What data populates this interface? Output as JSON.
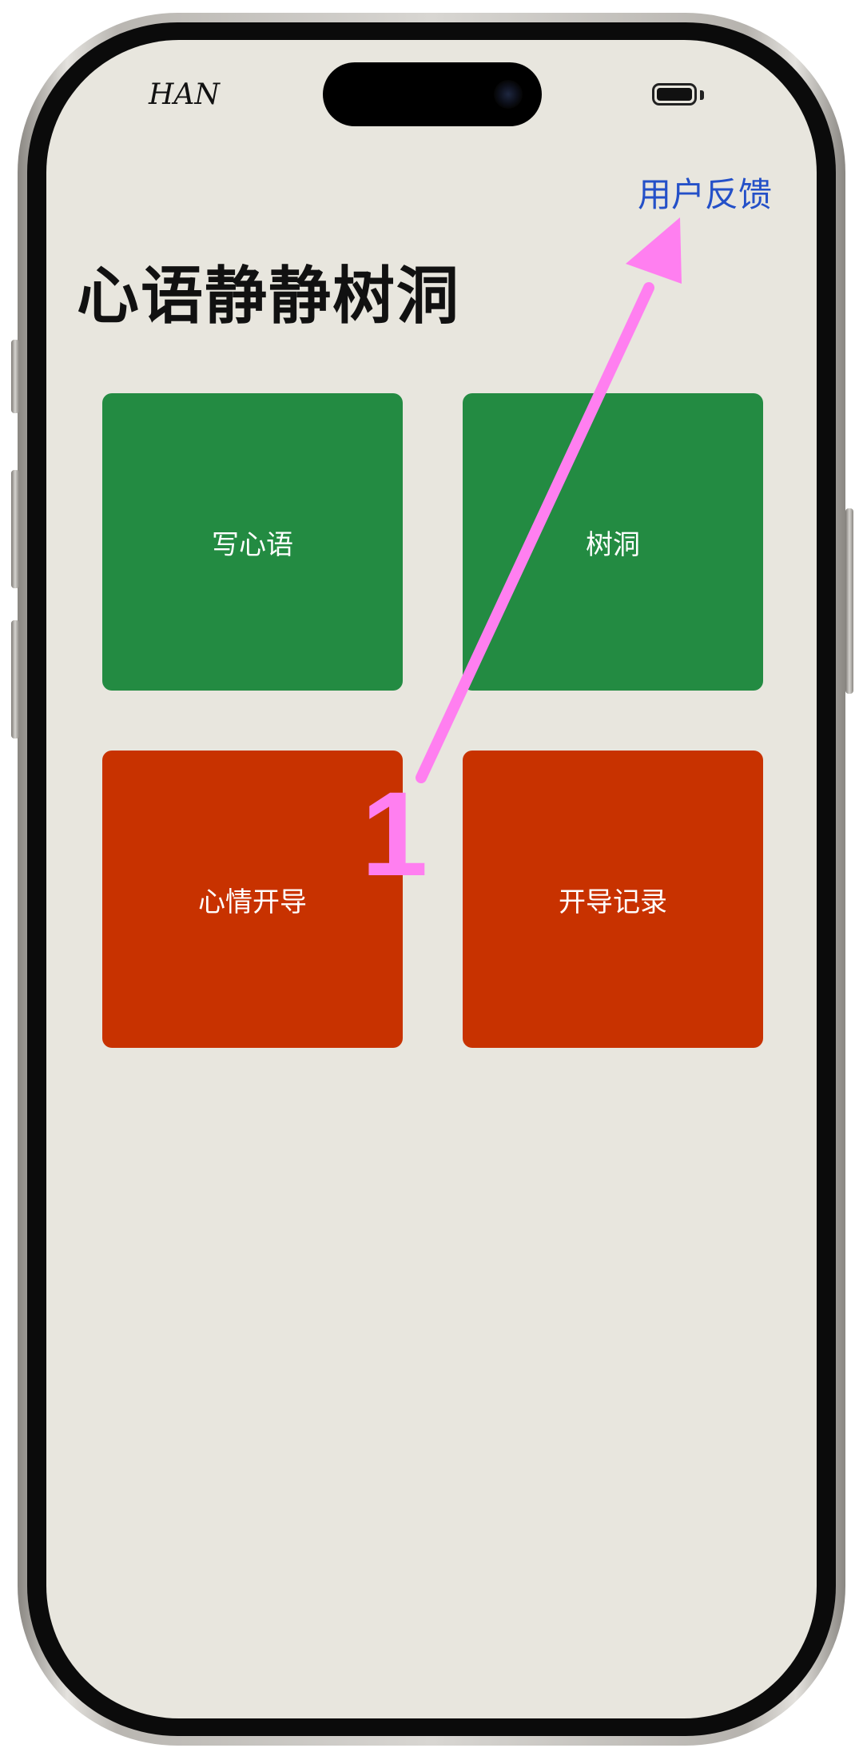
{
  "status_bar": {
    "carrier": "HAN"
  },
  "header": {
    "feedback_link": "用户反馈"
  },
  "page": {
    "title": "心语静静树洞"
  },
  "tiles": [
    {
      "label": "写心语",
      "color": "#238b42"
    },
    {
      "label": "树洞",
      "color": "#238b42"
    },
    {
      "label": "心情开导",
      "color": "#c83200"
    },
    {
      "label": "开导记录",
      "color": "#c83200"
    }
  ],
  "annotation": {
    "number": "1",
    "color": "#ff7ff0"
  },
  "colors": {
    "background": "#e8e6de",
    "link": "#2450c8"
  }
}
